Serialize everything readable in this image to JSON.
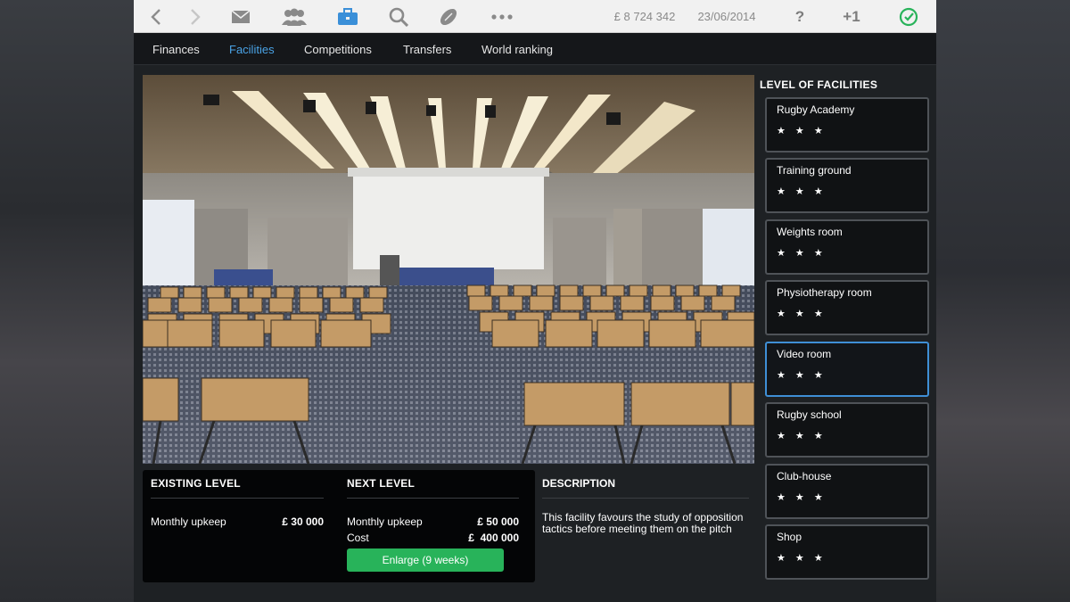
{
  "toolbar": {
    "money": "£ 8 724 342",
    "date": "23/06/2014",
    "help_label": "?",
    "plus_label": "+1",
    "icons": [
      "back-arrow-icon",
      "forward-arrow-icon",
      "mail-icon",
      "team-icon",
      "briefcase-icon",
      "search-icon",
      "rugby-ball-icon",
      "more-icon",
      "help-icon",
      "clock-check-icon"
    ]
  },
  "subnav": {
    "items": [
      {
        "label": "Finances"
      },
      {
        "label": "Facilities"
      },
      {
        "label": "Competitions"
      },
      {
        "label": "Transfers"
      },
      {
        "label": "World ranking"
      }
    ],
    "active_index": 1
  },
  "details": {
    "existing": {
      "heading": "EXISTING LEVEL",
      "upkeep_label": "Monthly upkeep",
      "upkeep_value": "£ 30 000"
    },
    "next": {
      "heading": "NEXT LEVEL",
      "upkeep_label": "Monthly upkeep",
      "upkeep_value": "£ 50 000",
      "cost_label": "Cost",
      "cost_value": "£  400 000",
      "button_label": "Enlarge (9 weeks)"
    },
    "description": {
      "heading": "DESCRIPTION",
      "text": "This facility favours the study of opposition tactics before meeting them on the pitch"
    }
  },
  "facilities": {
    "title": "LEVEL OF FACILITIES",
    "selected_index": 4,
    "items": [
      {
        "name": "Rugby Academy",
        "stars": "★ ★ ★",
        "rating": 3
      },
      {
        "name": "Training ground",
        "stars": "★ ★ ★",
        "rating": 3
      },
      {
        "name": "Weights room",
        "stars": "★ ★ ★",
        "rating": 3
      },
      {
        "name": "Physiotherapy room",
        "stars": "★ ★ ★",
        "rating": 3
      },
      {
        "name": "Video room",
        "stars": "★ ★ ★",
        "rating": 3
      },
      {
        "name": "Rugby school",
        "stars": "★ ★ ★",
        "rating": 3
      },
      {
        "name": "Club-house",
        "stars": "★ ★ ★",
        "rating": 3
      },
      {
        "name": "Shop",
        "stars": "★ ★ ★",
        "rating": 3
      }
    ]
  },
  "colors": {
    "accent_blue": "#3a8fd8",
    "button_green": "#28b35a",
    "toolbar_bg": "#f1f1f1"
  }
}
